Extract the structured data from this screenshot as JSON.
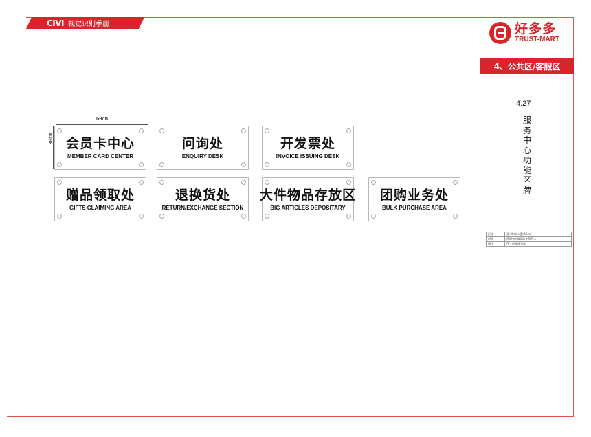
{
  "header": {
    "brand_ci": "CIVI",
    "brand_title": "视觉识别手册"
  },
  "logo": {
    "cn": "好多多",
    "en": "TRUST-MART"
  },
  "section": {
    "title": "4、公共区/客服区",
    "number": "4.27",
    "name": "服务中心功能区牌"
  },
  "dimensions": {
    "width": "60cm",
    "height": "30cm"
  },
  "signs": [
    {
      "cn": "会员卡中心",
      "en": "MEMBER CARD CENTER"
    },
    {
      "cn": "问询处",
      "en": "ENQUIRY DESK"
    },
    {
      "cn": "开发票处",
      "en": "INVOICE ISSUING DESK"
    },
    {
      "cn": "赠品领取处",
      "en": "GIFTS CLAIMING AREA"
    },
    {
      "cn": "退换货处",
      "en": "RETURN/EXCHANGE SECTION"
    },
    {
      "cn": "大件物品存放区",
      "en": "BIG ARTICLES DEPOSITARY"
    },
    {
      "cn": "团购业务处",
      "en": "BULK PURCHASE AREA"
    }
  ],
  "spec": {
    "rows": [
      {
        "key": "尺寸",
        "value": "長:30cm×寬:60cm"
      },
      {
        "key": "材质",
        "value": "透明有机玻璃片+黑色字"
      },
      {
        "key": "备注",
        "value": "尺寸依现场为准"
      }
    ]
  },
  "colors": {
    "brand_red": "#d8242a",
    "frame": "#e0564f"
  }
}
